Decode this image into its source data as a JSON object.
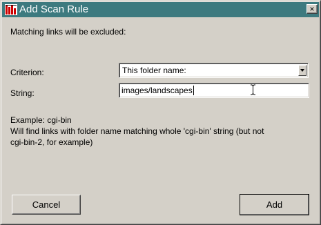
{
  "window": {
    "title": "Add Scan Rule",
    "close_glyph": "×",
    "app_icon": "bar-chart-icon",
    "titlebar_color": "#3d7a7f"
  },
  "intro_text": "Matching links will be excluded:",
  "criterion": {
    "label": "Criterion:",
    "selected": "This folder name:"
  },
  "string": {
    "label": "String:",
    "value": "images/landscapes"
  },
  "example": {
    "line1": "Example: cgi-bin",
    "line2": "Will find links with folder name matching whole 'cgi-bin' string (but not",
    "line3": "cgi-bin-2, for example)"
  },
  "buttons": {
    "cancel": "Cancel",
    "add": "Add"
  }
}
